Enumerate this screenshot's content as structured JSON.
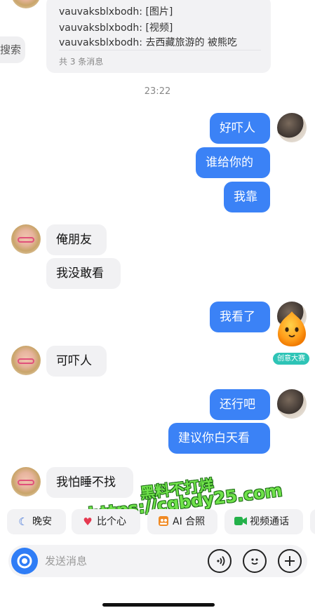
{
  "forward_card": {
    "lines": [
      "vauvaksblxbodh: [图片]",
      "vauvaksblxbodh: [视频]",
      "vauvaksblxbodh: 去西藏旅游的 被熊吃"
    ],
    "count": "共 3 条消息"
  },
  "search_pill": {
    "label": "搜索"
  },
  "timestamp": "23:22",
  "messages": [
    {
      "side": "out",
      "text": "好吓人"
    },
    {
      "side": "out",
      "text": "谁给你的"
    },
    {
      "side": "out",
      "text": "我靠"
    },
    {
      "side": "in",
      "text": "俺朋友"
    },
    {
      "side": "in",
      "text": "我没敢看"
    },
    {
      "side": "out",
      "text": "我看了"
    },
    {
      "side": "in",
      "text": "可吓人"
    },
    {
      "side": "out",
      "text": "还行吧"
    },
    {
      "side": "out",
      "text": "建议你白天看"
    },
    {
      "side": "in",
      "text": "我怕睡不找"
    }
  ],
  "mascot_badge": "创意大赛",
  "watermark": {
    "line1": "黑料不打烊",
    "line2": "https://cgbdy25.com"
  },
  "quick_actions": [
    {
      "label": "晚安",
      "icon": "moon-icon"
    },
    {
      "label": "比个心",
      "icon": "heart-icon"
    },
    {
      "label": "AI 合照",
      "icon": "photo-icon"
    },
    {
      "label": "视频通话",
      "icon": "video-camera-icon"
    }
  ],
  "input": {
    "placeholder": "发送消息"
  },
  "colors": {
    "accent": "#3b82f6",
    "incoming_bubble": "#f1f1f3",
    "watermark": "#6fe24a"
  }
}
